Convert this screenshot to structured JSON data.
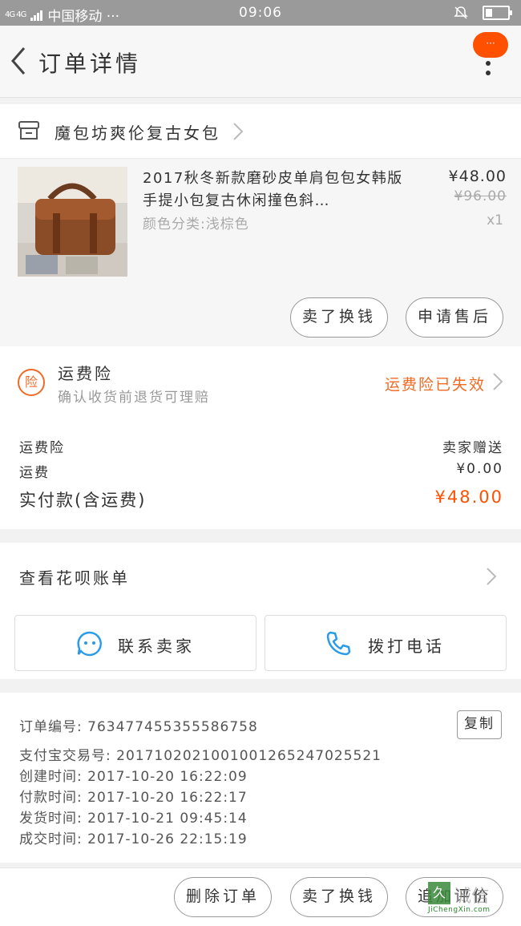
{
  "status_bar": {
    "signal": "4G 4G",
    "carrier": "中国移动 ···",
    "time": "09:06"
  },
  "nav": {
    "title": "订单详情",
    "more_label": "···"
  },
  "shop": {
    "name": "魔包坊爽伦复古女包"
  },
  "product": {
    "title": "2017秋冬新款磨砂皮单肩包包女韩版手提小包复古休闲撞色斜…",
    "sku": "颜色分类:浅棕色",
    "price": "¥48.00",
    "original_price": "¥96.00",
    "quantity": "x1",
    "buttons": [
      "卖了换钱",
      "申请售后"
    ]
  },
  "insurance": {
    "badge": "险",
    "title": "运费险",
    "subtitle": "确认收货前退货可理赔",
    "status": "运费险已失效"
  },
  "summary": {
    "rows": [
      {
        "label": "运费险",
        "value": "卖家赠送"
      },
      {
        "label": "运费",
        "value": "¥0.00"
      }
    ],
    "total_label": "实付款(含运费)",
    "total_value": "¥48.00"
  },
  "huabei": {
    "label": "查看花呗账单"
  },
  "actions": {
    "contact_seller": "联系卖家",
    "call": "拨打电话"
  },
  "order_info": {
    "order_no": "订单编号: 763477455355586758",
    "copy_label": "复制",
    "alipay_no": "支付宝交易号: 2017102021001001265247025521",
    "created": "创建时间: 2017-10-20 16:22:09",
    "paid": "付款时间: 2017-10-20 16:22:17",
    "shipped": "发货时间: 2017-10-21 09:45:14",
    "completed": "成交时间: 2017-10-26 22:15:19"
  },
  "bottom_bar": {
    "delete": "删除订单",
    "resell": "卖了换钱",
    "review": "追加评价"
  },
  "watermark": {
    "box": "久",
    "text": "诚信",
    "url": "JiChengXin.com"
  },
  "colors": {
    "accent": "#ff5000",
    "orange_text": "#f06a24",
    "icon_blue": "#2a9be8"
  }
}
